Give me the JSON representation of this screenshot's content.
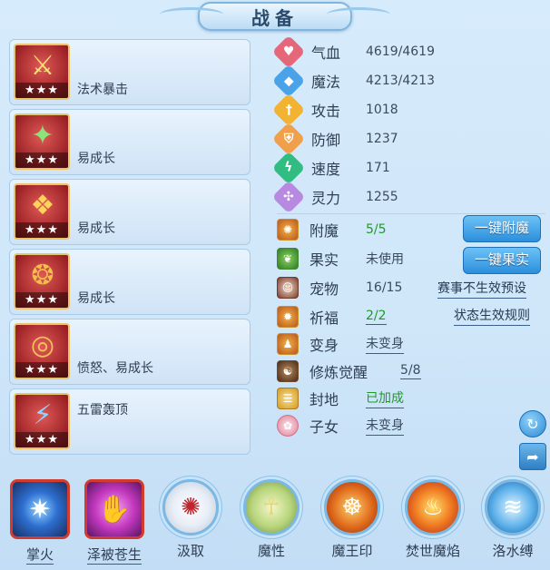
{
  "window_title": "战备",
  "equipment": [
    {
      "label": "法术暴击",
      "stars": "★★★",
      "icon": "weapon-icon"
    },
    {
      "label": "易成长",
      "stars": "★★★",
      "icon": "staff-icon"
    },
    {
      "label": "易成长",
      "stars": "★★★",
      "icon": "armor-icon"
    },
    {
      "label": "易成长",
      "stars": "★★★",
      "icon": "necklace-icon"
    },
    {
      "label": "愤怒、易成长",
      "stars": "★★★",
      "icon": "belt-icon"
    },
    {
      "label": "五雷轰顶",
      "stars": "★★★",
      "icon": "boots-icon"
    }
  ],
  "stats": [
    {
      "label": "气血",
      "value": "4619/4619",
      "color": "#e4677a",
      "icon": "heart-icon"
    },
    {
      "label": "魔法",
      "value": "4213/4213",
      "color": "#4aa3e8",
      "icon": "diamond-icon"
    },
    {
      "label": "攻击",
      "value": "1018",
      "color": "#f2b333",
      "icon": "sword-icon"
    },
    {
      "label": "防御",
      "value": "1237",
      "color": "#f0a04a",
      "icon": "shield-icon"
    },
    {
      "label": "速度",
      "value": "171",
      "color": "#31bd82",
      "icon": "lightning-icon"
    },
    {
      "label": "灵力",
      "value": "1255",
      "color": "#b889e0",
      "icon": "spirit-icon"
    }
  ],
  "attributes": [
    {
      "label": "附魔",
      "value": "5/5",
      "green": true
    },
    {
      "label": "果实",
      "value": "未使用",
      "green": false
    },
    {
      "label": "宠物",
      "value": "16/15",
      "green": false
    },
    {
      "label": "祈福",
      "value": "2/2",
      "green": true
    },
    {
      "label": "变身",
      "value": "未变身",
      "green": false
    },
    {
      "label": "修炼觉醒",
      "value": "5/8",
      "green": false
    },
    {
      "label": "封地",
      "value": "已加成",
      "green": true
    },
    {
      "label": "子女",
      "value": "未变身",
      "green": false
    }
  ],
  "buttons": {
    "enchant": "一键附魔",
    "fruit": "一键果实"
  },
  "links": {
    "preset": "赛事不生效预设",
    "rules": "状态生效规则"
  },
  "skills": [
    {
      "label": "掌火",
      "color": "#2d6fd0"
    },
    {
      "label": "泽被苍生",
      "color": "#c43ac0"
    },
    {
      "label": "汲取",
      "color": "#e8eef6"
    },
    {
      "label": "魔性",
      "color": "#b6d47a"
    },
    {
      "label": "魔王印",
      "color": "#e06a1c"
    },
    {
      "label": "焚世魔焰",
      "color": "#f07b22"
    },
    {
      "label": "洛水缚",
      "color": "#5cb0ea"
    }
  ]
}
